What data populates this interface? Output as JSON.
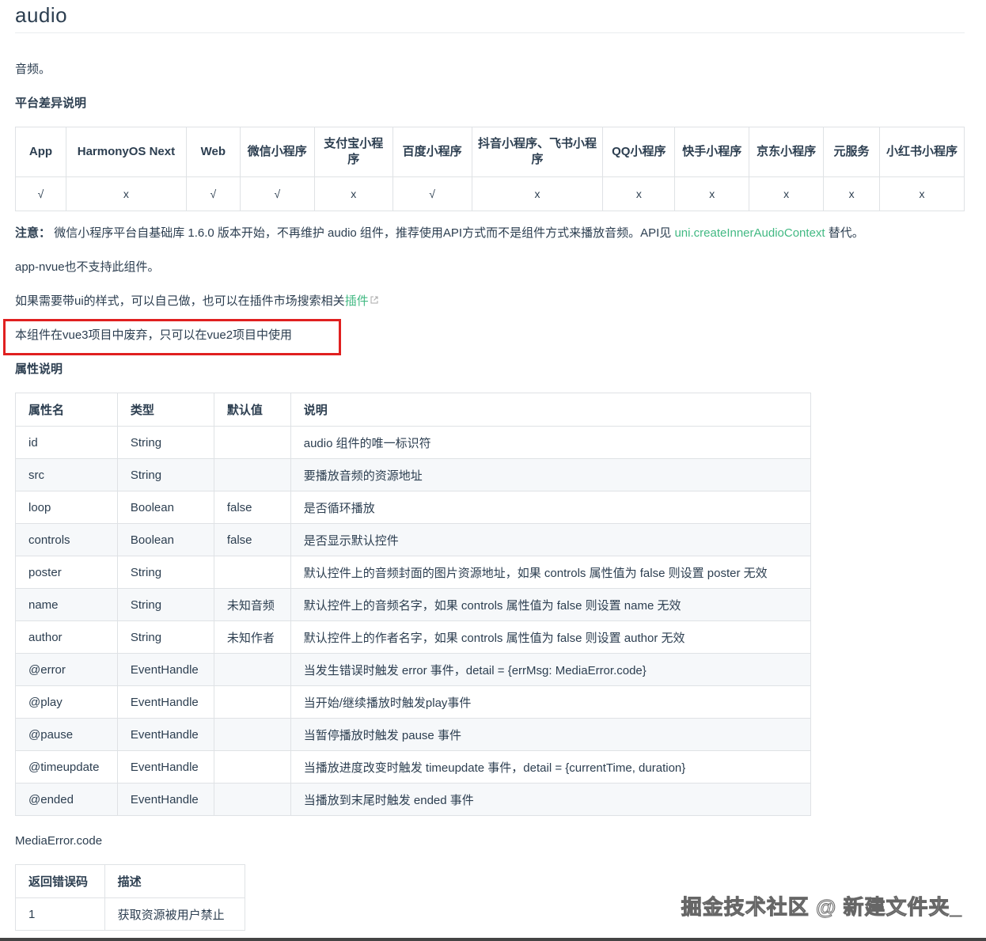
{
  "title": "audio",
  "intro": "音频。",
  "platform_heading": "平台差异说明",
  "platform_table": {
    "headers": [
      "App",
      "HarmonyOS Next",
      "Web",
      "微信小程序",
      "支付宝小程序",
      "百度小程序",
      "抖音小程序、飞书小程序",
      "QQ小程序",
      "快手小程序",
      "京东小程序",
      "元服务",
      "小红书小程序"
    ],
    "values": [
      "√",
      "x",
      "√",
      "√",
      "x",
      "√",
      "x",
      "x",
      "x",
      "x",
      "x",
      "x"
    ]
  },
  "note": {
    "label": "注意：",
    "text": "微信小程序平台自基础库 1.6.0 版本开始，不再维护 audio 组件，推荐使用API方式而不是组件方式来播放音频。API见",
    "link": "uni.createInnerAudioContext",
    "suffix": "替代。"
  },
  "nvue_note": "app-nvue也不支持此组件。",
  "ui_note": {
    "text": "如果需要带ui的样式，可以自己做，也可以在插件市场搜索相关",
    "link": "插件"
  },
  "deprecated_note": "本组件在vue3项目中废弃，只可以在vue2项目中使用",
  "attr_heading": "属性说明",
  "attr_table": {
    "headers": [
      "属性名",
      "类型",
      "默认值",
      "说明"
    ],
    "rows": [
      [
        "id",
        "String",
        "",
        "audio 组件的唯一标识符"
      ],
      [
        "src",
        "String",
        "",
        "要播放音频的资源地址"
      ],
      [
        "loop",
        "Boolean",
        "false",
        "是否循环播放"
      ],
      [
        "controls",
        "Boolean",
        "false",
        "是否显示默认控件"
      ],
      [
        "poster",
        "String",
        "",
        "默认控件上的音频封面的图片资源地址，如果 controls 属性值为 false 则设置 poster 无效"
      ],
      [
        "name",
        "String",
        "未知音频",
        "默认控件上的音频名字，如果 controls 属性值为 false 则设置 name 无效"
      ],
      [
        "author",
        "String",
        "未知作者",
        "默认控件上的作者名字，如果 controls 属性值为 false 则设置 author 无效"
      ],
      [
        "@error",
        "EventHandle",
        "",
        "当发生错误时触发 error 事件，detail = {errMsg: MediaError.code}"
      ],
      [
        "@play",
        "EventHandle",
        "",
        "当开始/继续播放时触发play事件"
      ],
      [
        "@pause",
        "EventHandle",
        "",
        "当暂停播放时触发 pause 事件"
      ],
      [
        "@timeupdate",
        "EventHandle",
        "",
        "当播放进度改变时触发 timeupdate 事件，detail = {currentTime, duration}"
      ],
      [
        "@ended",
        "EventHandle",
        "",
        "当播放到末尾时触发 ended 事件"
      ]
    ]
  },
  "mediaerror_heading": "MediaError.code",
  "error_table": {
    "headers": [
      "返回错误码",
      "描述"
    ],
    "rows": [
      [
        "1",
        "获取资源被用户禁止"
      ]
    ]
  },
  "watermark": "掘金技术社区 @ 新建文件夹_"
}
